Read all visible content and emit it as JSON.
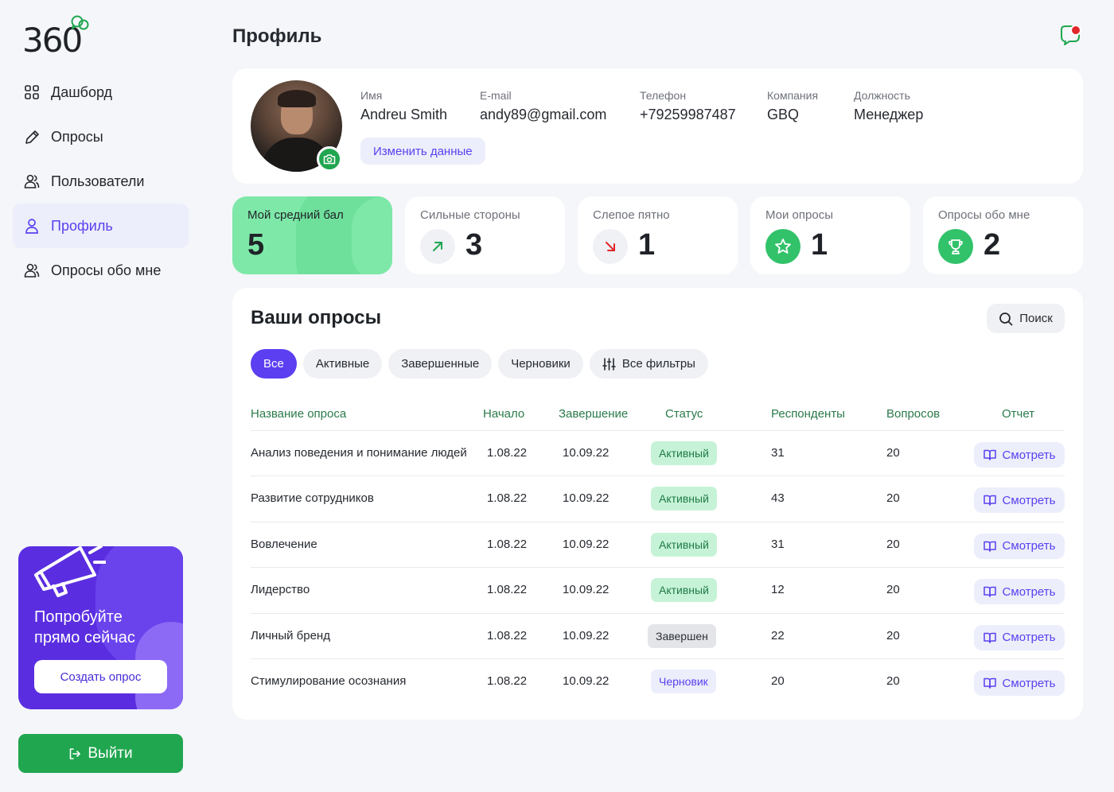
{
  "logo": "360",
  "sidebar": {
    "items": [
      {
        "label": "Дашборд",
        "icon": "grid-icon"
      },
      {
        "label": "Опросы",
        "icon": "pencil-icon"
      },
      {
        "label": "Пользователи",
        "icon": "users-icon"
      },
      {
        "label": "Профиль",
        "icon": "user-icon",
        "active": true
      },
      {
        "label": "Опросы обо мне",
        "icon": "users-icon"
      }
    ],
    "promo": {
      "title": "Попробуйте прямо сейчас",
      "button": "Создать опрос"
    },
    "logout": "Выйти"
  },
  "header": {
    "title": "Профиль"
  },
  "profile": {
    "name_label": "Имя",
    "name": "Andreu Smith",
    "email_label": "E-mail",
    "email": "andy89@gmail.com",
    "phone_label": "Телефон",
    "phone": "+79259987487",
    "company_label": "Компания",
    "company": "GBQ",
    "position_label": "Должность",
    "position": "Менеджер",
    "edit_button": "Изменить данные"
  },
  "stats": [
    {
      "label": "Мой средний бал",
      "value": "5"
    },
    {
      "label": "Сильные стороны",
      "value": "3",
      "icon": "arrow-up-right-icon"
    },
    {
      "label": "Слепое пятно",
      "value": "1",
      "icon": "arrow-down-right-icon"
    },
    {
      "label": "Мои опросы",
      "value": "1",
      "icon": "star-icon"
    },
    {
      "label": "Опросы обо мне",
      "value": "2",
      "icon": "trophy-icon"
    }
  ],
  "surveys": {
    "title": "Ваши опросы",
    "search": "Поиск",
    "filters": [
      "Все",
      "Активные",
      "Завершенные",
      "Черновики",
      "Все фильтры"
    ],
    "columns": [
      "Название опроса",
      "Начало",
      "Завершение",
      "Статус",
      "Респонденты",
      "Вопросов",
      "Отчет"
    ],
    "view_label": "Смотреть",
    "rows": [
      {
        "name": "Анализ поведения и понимание людей",
        "start": "1.08.22",
        "end": "10.09.22",
        "status": "Активный",
        "status_type": "active",
        "respondents": "31",
        "questions": "20"
      },
      {
        "name": "Развитие сотрудников",
        "start": "1.08.22",
        "end": "10.09.22",
        "status": "Активный",
        "status_type": "active",
        "respondents": "43",
        "questions": "20"
      },
      {
        "name": "Вовлечение",
        "start": "1.08.22",
        "end": "10.09.22",
        "status": "Активный",
        "status_type": "active",
        "respondents": "31",
        "questions": "20"
      },
      {
        "name": "Лидерство",
        "start": "1.08.22",
        "end": "10.09.22",
        "status": "Активный",
        "status_type": "active",
        "respondents": "12",
        "questions": "20"
      },
      {
        "name": "Личный бренд",
        "start": "1.08.22",
        "end": "10.09.22",
        "status": "Завершен",
        "status_type": "done",
        "respondents": "22",
        "questions": "20"
      },
      {
        "name": "Стимулирование осознания",
        "start": "1.08.22",
        "end": "10.09.22",
        "status": "Черновик",
        "status_type": "draft",
        "respondents": "20",
        "questions": "20"
      }
    ]
  },
  "colors": {
    "accent": "#5b3ff0",
    "green": "#21a650",
    "mint": "#7ee8a8"
  }
}
